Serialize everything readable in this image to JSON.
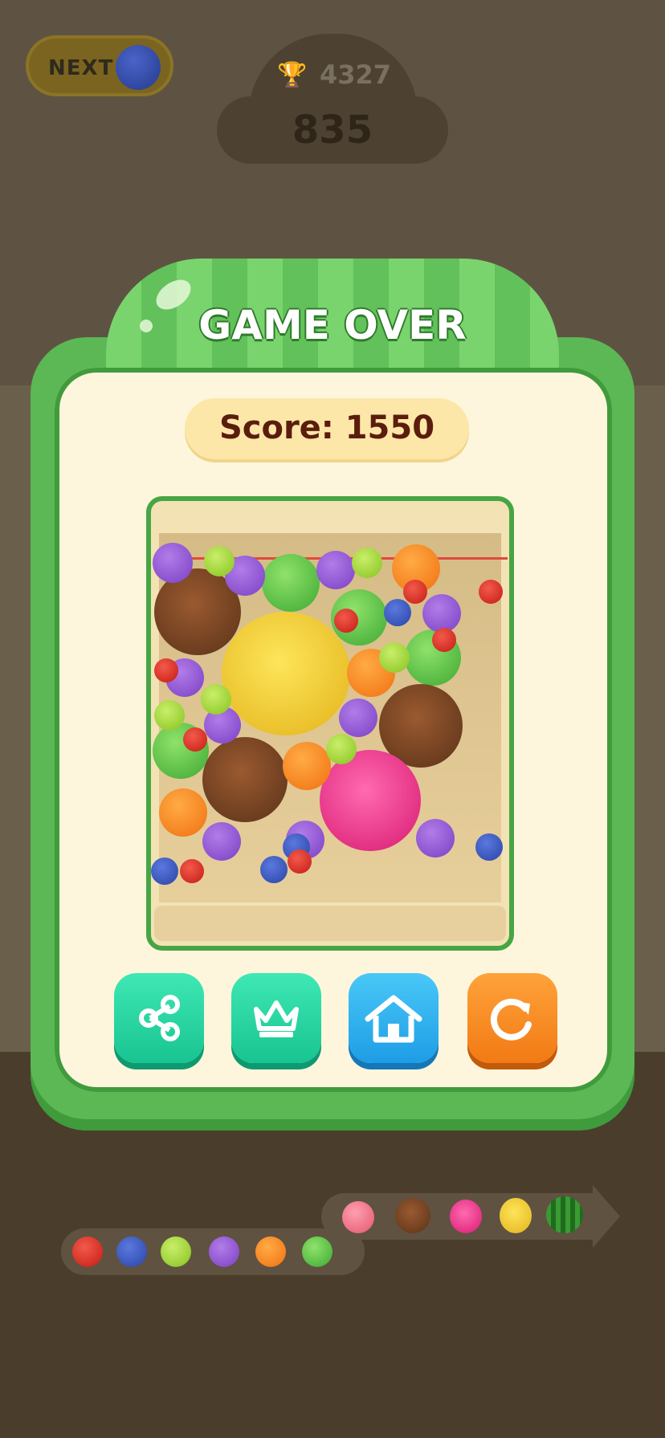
{
  "hud": {
    "next_label": "NEXT",
    "next_fruit": "blueberry",
    "best_score": "4327",
    "current_score": "835",
    "trophy_icon": "trophy-icon"
  },
  "dialog": {
    "title": "GAME OVER",
    "score_text": "Score: 1550"
  },
  "buttons": [
    {
      "name": "share-button",
      "icon": "share-icon"
    },
    {
      "name": "leaderboard-button",
      "icon": "crown-icon"
    },
    {
      "name": "home-button",
      "icon": "home-icon"
    },
    {
      "name": "restart-button",
      "icon": "restart-icon"
    }
  ],
  "evolution_chain": [
    "cherry",
    "blueberry",
    "lime",
    "grape",
    "orange",
    "apple",
    "peach",
    "coconut",
    "dragonfruit",
    "pineapple",
    "watermelon"
  ],
  "colors": {
    "panel_green": "#5cb755",
    "panel_cream": "#fdf6dc",
    "score_text": "#5a1d0d",
    "share_teal": "#18c491",
    "home_blue": "#1e9de6",
    "restart_orange": "#f27a14"
  }
}
